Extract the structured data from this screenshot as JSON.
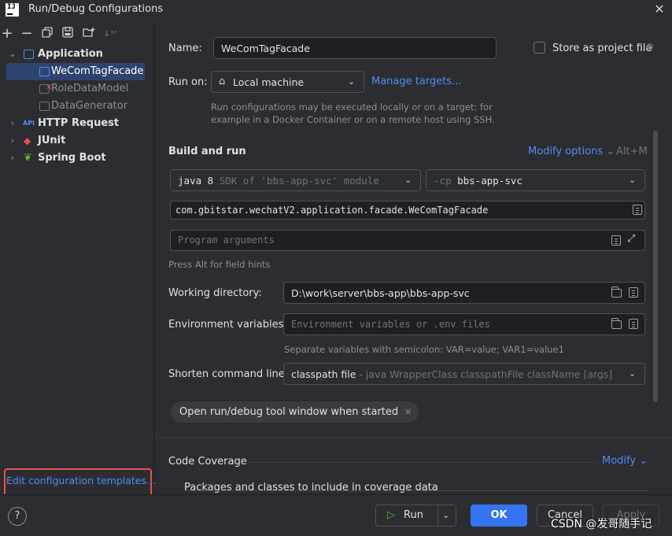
{
  "window": {
    "title": "Run/Debug Configurations",
    "logo": "IJ"
  },
  "toolbar": {
    "icons": [
      "add-icon",
      "remove-icon",
      "copy-icon",
      "save-icon",
      "new-folder-icon",
      "sort-icon"
    ],
    "add": "+",
    "remove": "−"
  },
  "tree": {
    "application": "Application",
    "children": [
      "WeComTagFacade",
      "RoleDataModel",
      "DataGenerator"
    ],
    "http_request": "HTTP Request",
    "junit": "JUnit",
    "spring_boot": "Spring Boot",
    "api_badge": "API"
  },
  "edit_templates": "Edit configuration templates...",
  "form": {
    "name_label": "Name:",
    "name_value": "WeComTagFacade",
    "store_label": "Store as project file",
    "run_on_label": "Run on:",
    "run_on_value": "Local machine",
    "manage_targets": "Manage targets...",
    "run_on_hint_1": "Run configurations may be executed locally or on a target: for",
    "run_on_hint_2": "example in a Docker Container or on a remote host using SSH.",
    "build_and_run": "Build and run",
    "modify_options": "Modify options",
    "modify_shortcut": "Alt+M",
    "jdk_bold": "java 8",
    "jdk_rest": "SDK of 'bbs-app-svc' module",
    "cp_flag": "-cp",
    "cp_value": "bbs-app-svc",
    "main_class": "com.gbitstar.wechatV2.application.facade.WeComTagFacade",
    "program_args_placeholder": "Program arguments",
    "press_alt_hint": "Press Alt for field hints",
    "working_dir_label": "Working directory:",
    "working_dir_value": "D:\\work\\server\\bbs-app\\bbs-app-svc",
    "env_label": "Environment variables:",
    "env_placeholder": "Environment variables or .env files",
    "env_hint": "Separate variables with semicolon: VAR=value; VAR1=value1",
    "shorten_label": "Shorten command line:",
    "shorten_value": "classpath file",
    "shorten_hint": " - java WrapperClass classpathFile className [args]",
    "chip": "Open run/debug tool window when started",
    "code_coverage": "Code Coverage",
    "modify": "Modify",
    "packages_classes": "Packages and classes to include in coverage data"
  },
  "buttons": {
    "run": "Run",
    "ok": "OK",
    "cancel": "Cancel",
    "apply": "Apply",
    "help": "?"
  },
  "watermark": "CSDN @发哥随手记",
  "colors": {
    "accent": "#3574f0",
    "link": "#548af7",
    "selection": "#2e436e",
    "highlight_box": "#e8524a"
  }
}
